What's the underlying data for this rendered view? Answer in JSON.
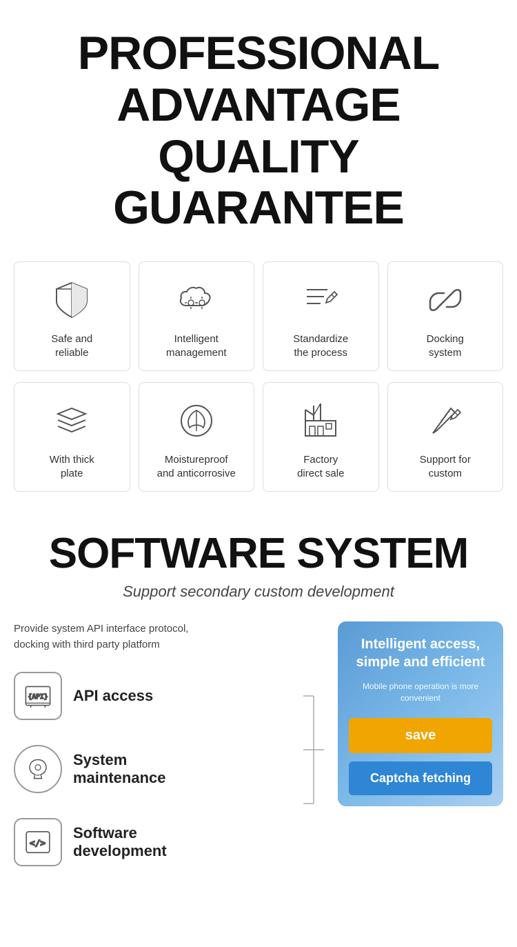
{
  "header": {
    "line1": "PROFESSIONAL",
    "line2": "ADVANTAGE",
    "line3": "QUALITY GUARANTEE"
  },
  "features_row1": [
    {
      "id": "safe-reliable",
      "label": "Safe and\nreliable",
      "icon": "shield"
    },
    {
      "id": "intelligent-management",
      "label": "Intelligent\nmanagement",
      "icon": "cloud-gear"
    },
    {
      "id": "standardize-process",
      "label": "Standardize\nthe process",
      "icon": "pencil-lines"
    },
    {
      "id": "docking-system",
      "label": "Docking\nsystem",
      "icon": "link"
    }
  ],
  "features_row2": [
    {
      "id": "thick-plate",
      "label": "With thick\nplate",
      "icon": "layers"
    },
    {
      "id": "moistureproof",
      "label": "Moistureproof\nand anticorrosive",
      "icon": "shield-leaf"
    },
    {
      "id": "factory-direct",
      "label": "Factory\ndirect sale",
      "icon": "factory"
    },
    {
      "id": "support-custom",
      "label": "Support for\ncustom",
      "icon": "pen-ruler"
    }
  ],
  "software": {
    "title": "SOFTWARE SYSTEM",
    "subtitle": "Support secondary custom development",
    "description": "Provide system API interface protocol,\ndocking with third party platform",
    "items": [
      {
        "id": "api-access",
        "label": "API access",
        "icon": "api"
      },
      {
        "id": "system-maintenance",
        "label": "System\nmaintenance",
        "icon": "maintenance"
      },
      {
        "id": "software-development",
        "label": "Software\ndevelopment",
        "icon": "code"
      }
    ],
    "panel": {
      "title": "Intelligent access,\nsimple and efficient",
      "subtitle": "Mobile phone operation is more convenient",
      "btn_save": "save",
      "btn_captcha": "Captcha fetching"
    }
  }
}
